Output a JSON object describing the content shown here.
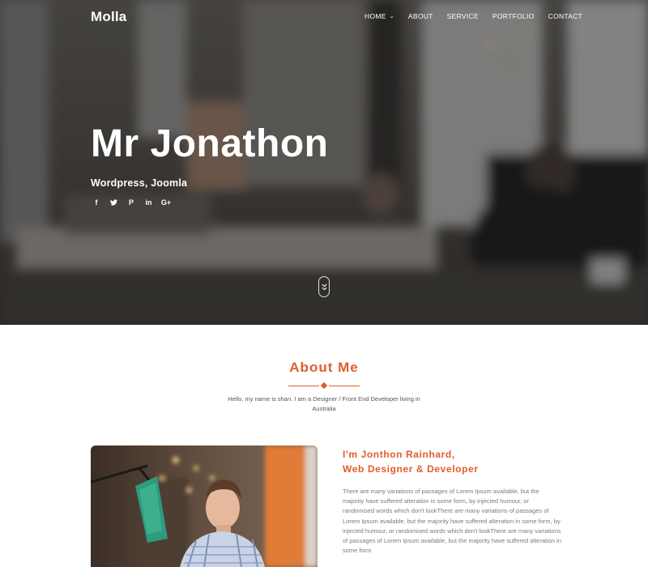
{
  "nav": {
    "brand": "Molla",
    "items": [
      {
        "label": "HOME",
        "dropdown": true
      },
      {
        "label": "ABOUT"
      },
      {
        "label": "SERVICE"
      },
      {
        "label": "PORTFOLIO"
      },
      {
        "label": "CONTACT"
      }
    ]
  },
  "hero": {
    "title": "Mr Jonathon",
    "subtitle": "Wordpress, Joomla",
    "socials": [
      {
        "icon": "facebook-icon",
        "glyph": "f"
      },
      {
        "icon": "twitter-icon",
        "glyph": ""
      },
      {
        "icon": "pinterest-icon",
        "glyph": "P"
      },
      {
        "icon": "linkedin-icon",
        "glyph": "in"
      },
      {
        "icon": "google-plus-icon",
        "glyph": "G+"
      }
    ],
    "scroll_icon": "chevron-double-down-icon"
  },
  "about": {
    "title": "About Me",
    "intro": "Hello, my name is shan. I am a Designer / Front End Developer living in Australia",
    "role_line1": "I'm Jonthon Rainhard,",
    "role_line2": "Web Designer & Developer",
    "bio": "There are many variations of passages of Lorem Ipsum available, but the majority have suffered alteration in some form, by injected humour, or randomised words which don't lookThere are many variations of passages of Lorem Ipsum available, but the majority have suffered alteration in some form, by injected humour, or randomised words which don't lookThere are many variations of passages of Lorem Ipsum available, but the majority have suffered alteration in some form"
  },
  "colors": {
    "accent": "#e05d2d",
    "text_muted": "#7a7a7a",
    "hero_overlay": "#141414"
  }
}
